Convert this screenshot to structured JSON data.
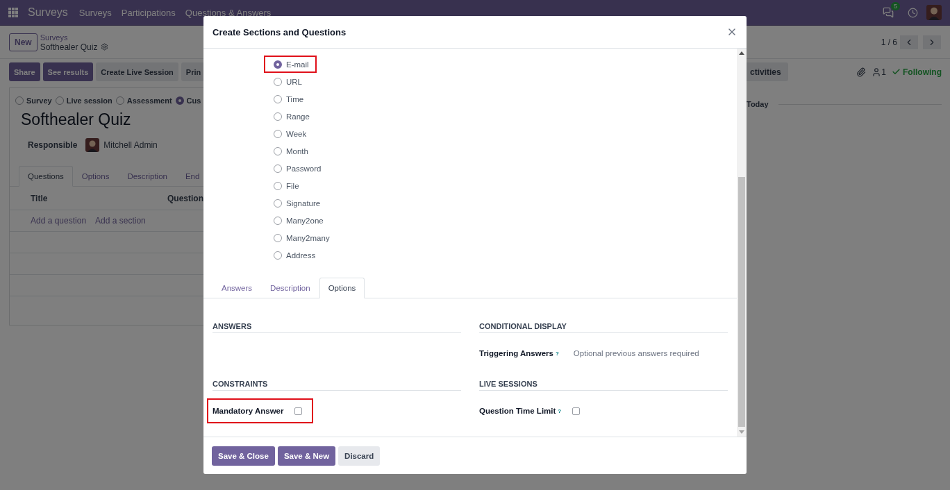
{
  "navbar": {
    "app_name": "Surveys",
    "menu": [
      "Surveys",
      "Participations",
      "Questions & Answers"
    ],
    "message_count": "5"
  },
  "control_panel": {
    "new_button": "New",
    "breadcrumb": "Surveys",
    "record_name": "Softhealer Quiz",
    "pager": "1 / 6"
  },
  "action_buttons": [
    {
      "label": "Share",
      "kind": "primary"
    },
    {
      "label": "See results",
      "kind": "primary"
    },
    {
      "label": "Create Live Session",
      "kind": "secondary"
    },
    {
      "label": "Prin",
      "kind": "secondary"
    }
  ],
  "chatter": {
    "activities_button": "ctivities",
    "follower_count": "1",
    "follow_label": "Following",
    "date_divider": "Today"
  },
  "sheet": {
    "survey_types": [
      {
        "label": "Survey",
        "selected": false
      },
      {
        "label": "Live session",
        "selected": false
      },
      {
        "label": "Assessment",
        "selected": false
      },
      {
        "label": "Cus",
        "selected": true
      }
    ],
    "title": "Softhealer Quiz",
    "responsible_label": "Responsible",
    "responsible": "Mitchell Admin",
    "tabs": [
      {
        "label": "Questions",
        "selected": true
      },
      {
        "label": "Options",
        "selected": false
      },
      {
        "label": "Description",
        "selected": false
      },
      {
        "label": "End",
        "selected": false
      }
    ],
    "columns": [
      "Title",
      "Question"
    ],
    "add_links": [
      "Add a question",
      "Add a section"
    ]
  },
  "dialog": {
    "title": "Create Sections and Questions",
    "question_types": [
      {
        "label": "E-mail",
        "selected": true,
        "highlighted": true
      },
      {
        "label": "URL",
        "selected": false,
        "highlighted": false
      },
      {
        "label": "Time",
        "selected": false,
        "highlighted": false
      },
      {
        "label": "Range",
        "selected": false,
        "highlighted": false
      },
      {
        "label": "Week",
        "selected": false,
        "highlighted": false
      },
      {
        "label": "Month",
        "selected": false,
        "highlighted": false
      },
      {
        "label": "Password",
        "selected": false,
        "highlighted": false
      },
      {
        "label": "File",
        "selected": false,
        "highlighted": false
      },
      {
        "label": "Signature",
        "selected": false,
        "highlighted": false
      },
      {
        "label": "Many2one",
        "selected": false,
        "highlighted": false
      },
      {
        "label": "Many2many",
        "selected": false,
        "highlighted": false
      },
      {
        "label": "Address",
        "selected": false,
        "highlighted": false
      }
    ],
    "tabs": [
      {
        "label": "Answers",
        "selected": false
      },
      {
        "label": "Description",
        "selected": false
      },
      {
        "label": "Options",
        "selected": true
      }
    ],
    "sections": [
      {
        "title": "ANSWERS"
      },
      {
        "title": "CONDITIONAL DISPLAY",
        "fields": [
          {
            "kind": "tags",
            "label": "Triggering Answers",
            "help": "?",
            "placeholder": "Optional previous answers required"
          }
        ]
      },
      {
        "title": "CONSTRAINTS",
        "fields": [
          {
            "kind": "checkbox",
            "label": "Mandatory Answer",
            "checked": false,
            "highlighted": true
          }
        ]
      },
      {
        "title": "LIVE SESSIONS",
        "fields": [
          {
            "kind": "checkbox",
            "label": "Question Time Limit",
            "help": "?",
            "checked": false,
            "highlighted": false
          }
        ]
      }
    ],
    "buttons": [
      {
        "label": "Save & Close",
        "kind": "primary"
      },
      {
        "label": "Save & New",
        "kind": "primary"
      },
      {
        "label": "Discard",
        "kind": "secondary"
      }
    ]
  }
}
